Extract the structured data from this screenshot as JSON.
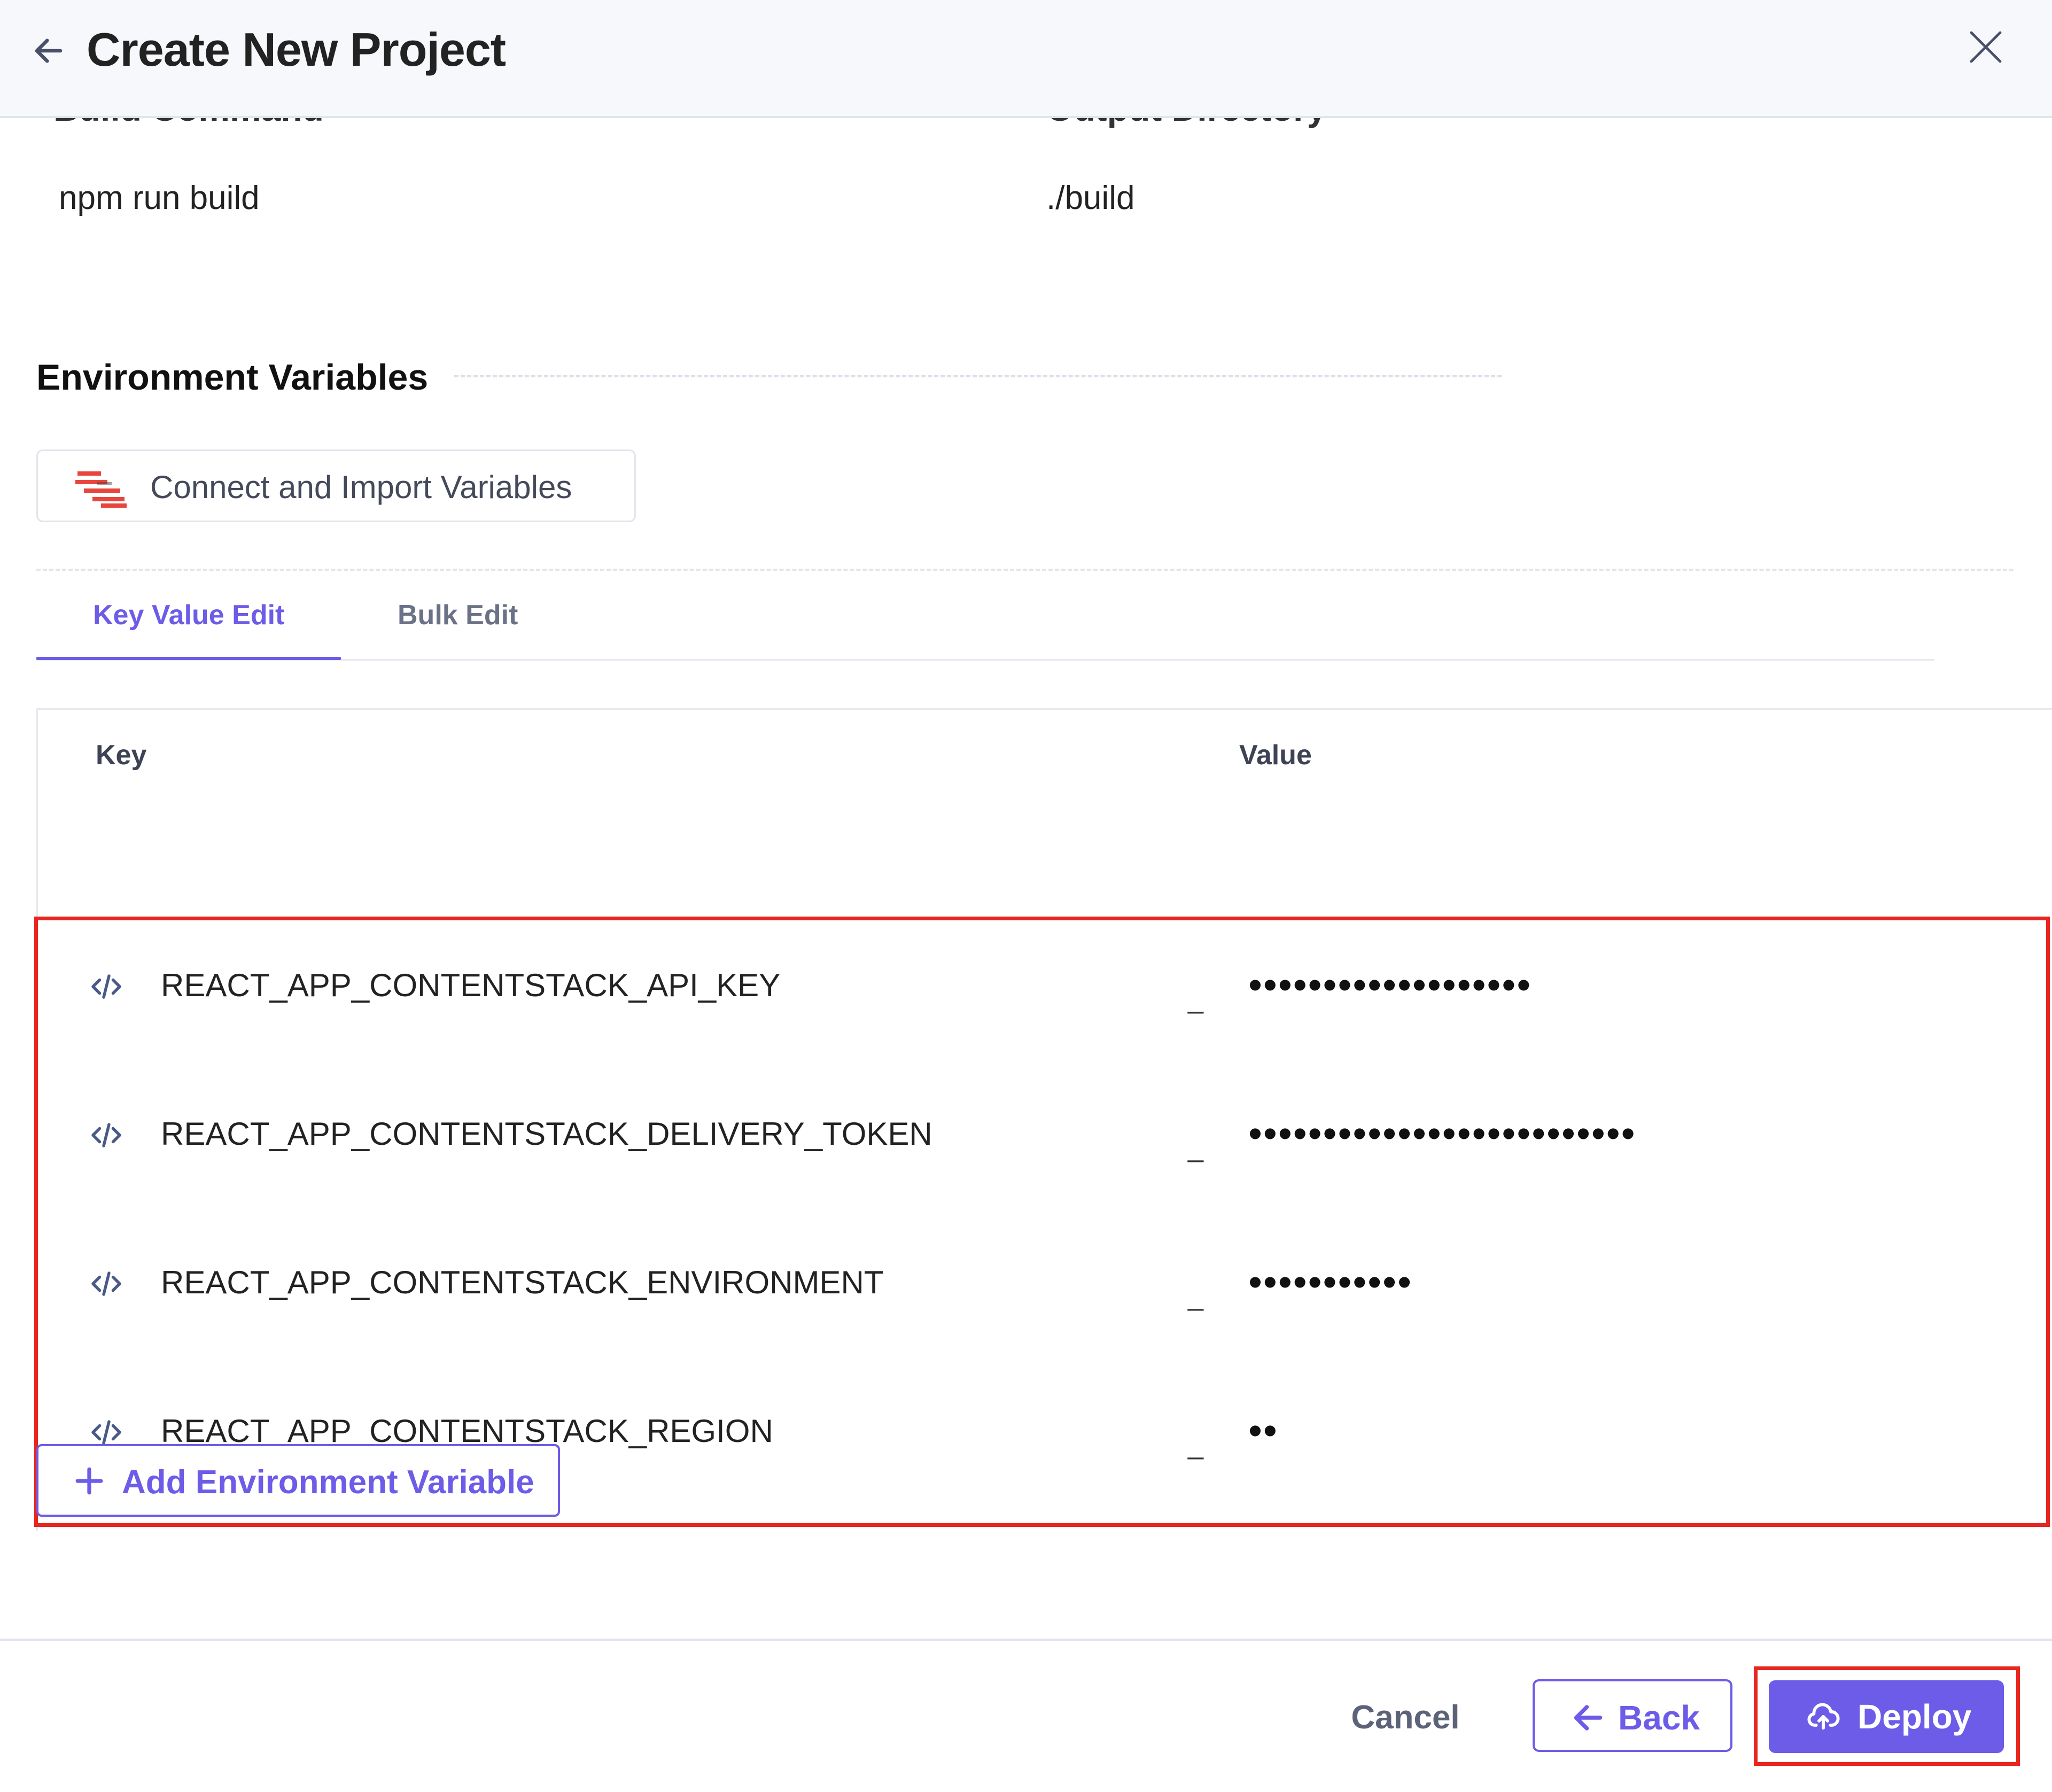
{
  "header": {
    "title": "Create New Project",
    "back_icon": "arrow-left-icon",
    "close_icon": "close-icon"
  },
  "build": {
    "build_command_label": "Build Command",
    "build_command_value": "npm run build",
    "output_directory_label": "Output Directory",
    "output_directory_value": "./build"
  },
  "env": {
    "title": "Environment Variables",
    "import_button": "Connect and Import Variables",
    "import_icon": "import-variables-icon",
    "tabs": [
      {
        "label": "Key Value Edit",
        "active": true
      },
      {
        "label": "Bulk Edit",
        "active": false
      }
    ],
    "table": {
      "key_header": "Key",
      "value_header": "Value",
      "rows": [
        {
          "key": "REACT_APP_CONTENTSTACK_API_KEY",
          "separator": "_",
          "value": "•••••••••••••••••••"
        },
        {
          "key": "REACT_APP_CONTENTSTACK_DELIVERY_TOKEN",
          "separator": "_",
          "value": "••••••••••••••••••••••••••"
        },
        {
          "key": "REACT_APP_CONTENTSTACK_ENVIRONMENT",
          "separator": "_",
          "value": "•••••••••••"
        },
        {
          "key": "REACT_APP_CONTENTSTACK_REGION",
          "separator": "_",
          "value": "••"
        }
      ]
    },
    "add_button": "Add Environment Variable"
  },
  "footer": {
    "cancel": "Cancel",
    "back": "Back",
    "deploy": "Deploy"
  },
  "colors": {
    "accent": "#6c5ce7",
    "highlight": "#e8251f"
  }
}
